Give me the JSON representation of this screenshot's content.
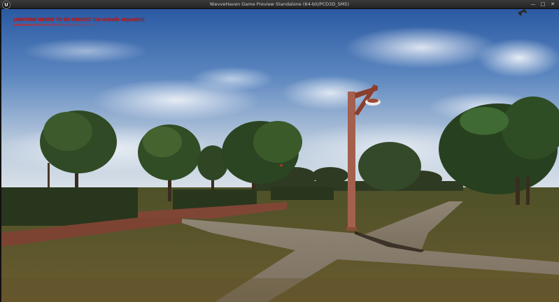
{
  "window": {
    "title": "NievveHaven Game Preview Standalone (64-bit/PCD3D_SM5)",
    "app_icon": "unreal-logo-icon",
    "app_icon_glyph": "U",
    "buttons": {
      "minimize": "—",
      "maximize": "□",
      "close": "✕"
    }
  },
  "overlay": {
    "lighting_warning": "LIGHTING NEEDS TO BE REBUILT (10 unbuilt object(s))",
    "warning_color": "#e02020",
    "crosshair_glyph": "+"
  },
  "scene": {
    "description_icons": [
      "sky",
      "trees",
      "street-lamp",
      "raised-planters",
      "gravel-path",
      "grass-lawn",
      "bird"
    ],
    "colors": {
      "sky_top": "#2f5fa8",
      "sky_horizon": "#cfd9e4",
      "grass": "#5b5a2c",
      "path": "#8d8171",
      "lamp": "#a45f4d",
      "planter": "#8a4c3a"
    }
  }
}
